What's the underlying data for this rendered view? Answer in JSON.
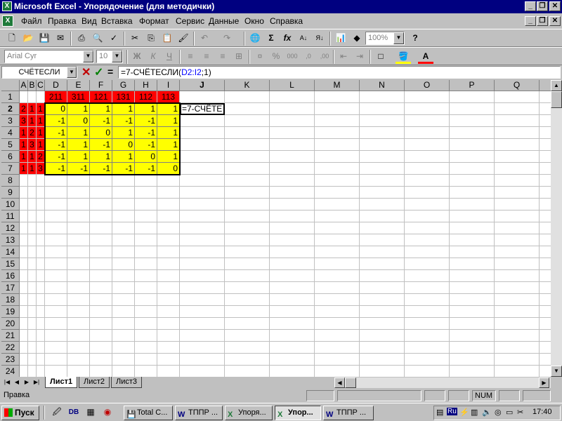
{
  "window": {
    "title": "Microsoft Excel - Упорядочение (для методички)"
  },
  "menu": [
    "Файл",
    "Правка",
    "Вид",
    "Вставка",
    "Формат",
    "Сервис",
    "Данные",
    "Окно",
    "Справка"
  ],
  "toolbar": {
    "zoom": "100%",
    "font": "Arial Cyr",
    "size": "10"
  },
  "formula_bar": {
    "name_box": "СЧЁТЕСЛИ",
    "formula_prefix": "=7-СЧЁТЕСЛИ(",
    "formula_range": "D2:I2",
    "formula_suffix": ";1)"
  },
  "columns": [
    "A",
    "B",
    "C",
    "D",
    "E",
    "F",
    "G",
    "H",
    "I",
    "J",
    "K",
    "L",
    "M",
    "N",
    "O",
    "P",
    "Q",
    "R"
  ],
  "rows": [
    "1",
    "2",
    "3",
    "4",
    "5",
    "6",
    "7",
    "8",
    "9",
    "10",
    "11",
    "12",
    "13",
    "14",
    "15",
    "16",
    "17",
    "18",
    "19",
    "20",
    "21",
    "22",
    "23",
    "24"
  ],
  "header_row": [
    "211",
    "311",
    "121",
    "131",
    "112",
    "113"
  ],
  "left_block": [
    [
      "2",
      "1",
      "1"
    ],
    [
      "3",
      "1",
      "1"
    ],
    [
      "1",
      "2",
      "1"
    ],
    [
      "1",
      "3",
      "1"
    ],
    [
      "1",
      "1",
      "2"
    ],
    [
      "1",
      "1",
      "3"
    ]
  ],
  "matrix": [
    [
      "0",
      "1",
      "1",
      "1",
      "1",
      "1"
    ],
    [
      "-1",
      "0",
      "-1",
      "-1",
      "-1",
      "1"
    ],
    [
      "-1",
      "1",
      "0",
      "1",
      "-1",
      "1"
    ],
    [
      "-1",
      "1",
      "-1",
      "0",
      "-1",
      "1"
    ],
    [
      "-1",
      "1",
      "1",
      "1",
      "0",
      "1"
    ],
    [
      "-1",
      "-1",
      "-1",
      "-1",
      "-1",
      "0"
    ]
  ],
  "editing_cell": "=7-СЧЁТЕ",
  "sheets": [
    "Лист1",
    "Лист2",
    "Лист3"
  ],
  "status": {
    "mode": "Правка",
    "num": "NUM"
  },
  "taskbar": {
    "start": "Пуск",
    "tasks": [
      "Total C...",
      "ТППР ...",
      "Упоря...",
      "Упор...",
      "ТППР ..."
    ],
    "clock": "17:40",
    "lang": "Ru"
  },
  "colors": {
    "red": "#ff0000",
    "yellow": "#ffff00",
    "title": "#000080",
    "formula_range": "#0000ff"
  }
}
